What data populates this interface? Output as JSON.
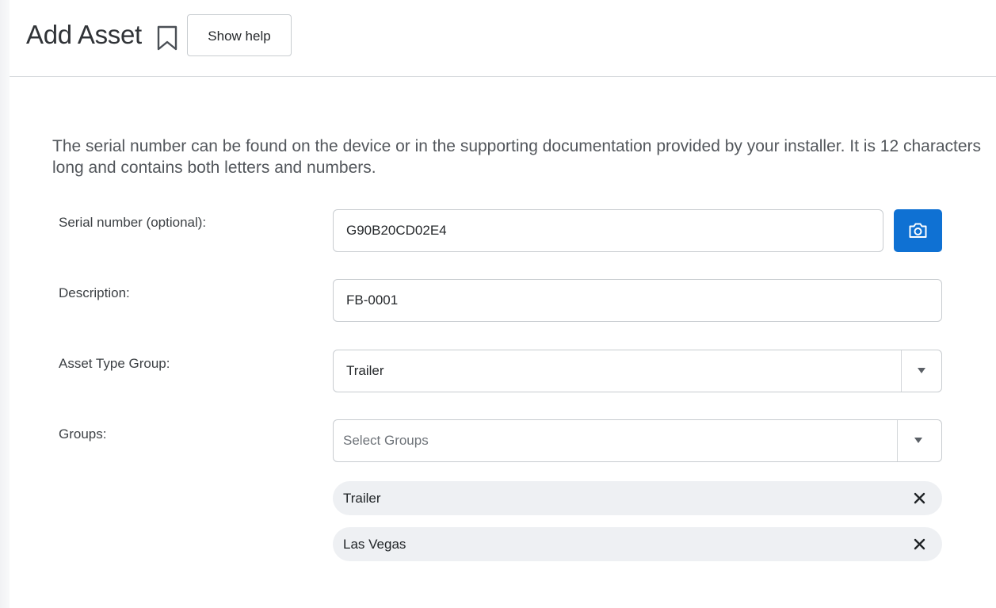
{
  "header": {
    "title": "Add Asset",
    "help_button_label": "Show help"
  },
  "instructions": "The serial number can be found on the device or in the supporting documentation provided by your installer. It is 12 characters long and contains both letters and numbers.",
  "form": {
    "serial_number": {
      "label": "Serial number (optional):",
      "value": "G90B20CD02E4"
    },
    "description": {
      "label": "Description:",
      "value": "FB-0001"
    },
    "asset_type_group": {
      "label": "Asset Type Group:",
      "selected": "Trailer"
    },
    "groups": {
      "label": "Groups:",
      "placeholder": "Select Groups",
      "selected": [
        {
          "label": "Trailer"
        },
        {
          "label": "Las Vegas"
        }
      ]
    }
  },
  "icons": {
    "bookmark": "bookmark-icon",
    "camera": "camera-icon",
    "dropdown": "chevron-down-icon",
    "remove": "close-icon"
  },
  "colors": {
    "accent": "#0f71d3",
    "chip_background": "#eef0f3",
    "border": "#c8ccd0"
  }
}
